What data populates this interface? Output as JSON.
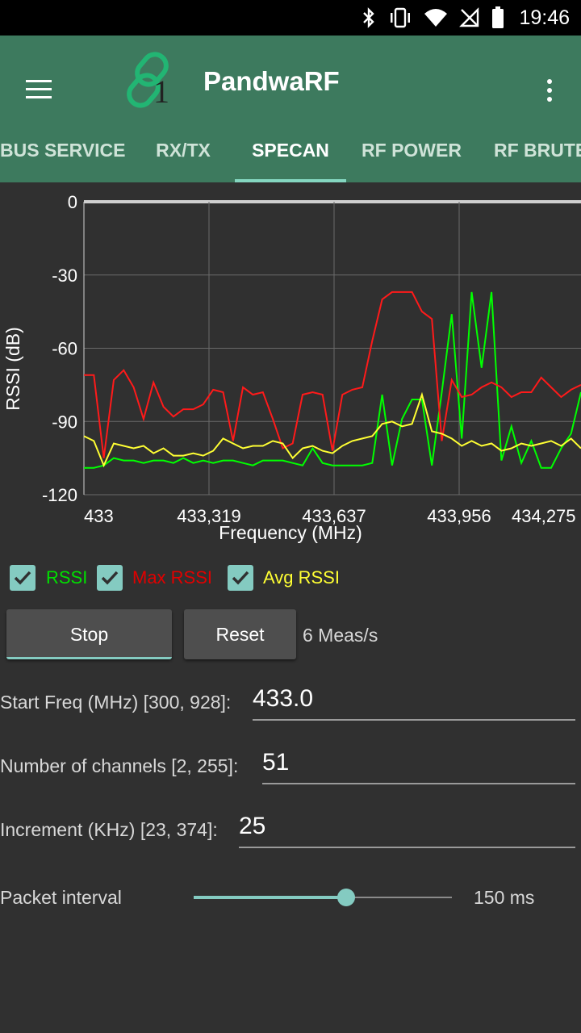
{
  "status_bar": {
    "time": "19:46",
    "icons": [
      "bluetooth-icon",
      "vibrate-icon",
      "wifi-icon",
      "no-signal-icon",
      "battery-icon"
    ]
  },
  "app_bar": {
    "title": "PandwaRF",
    "logo_number": "1",
    "tabs": [
      {
        "label": "BUS SERVICE"
      },
      {
        "label": "RX/TX"
      },
      {
        "label": "SPECAN"
      },
      {
        "label": "RF POWER"
      },
      {
        "label": "RF BRUTE"
      }
    ],
    "active_tab": "SPECAN"
  },
  "chart_data": {
    "type": "line",
    "xlabel": "Frequency (MHz)",
    "ylabel": "RSSI (dB)",
    "ylim": [
      -120,
      0
    ],
    "xlim": [
      433.0,
      434.25
    ],
    "x_ticks": [
      "433",
      "433,319",
      "433,637",
      "433,956",
      "434,275"
    ],
    "y_ticks": [
      "0",
      "-30",
      "-60",
      "-90",
      "-120"
    ],
    "grid": true,
    "x_start": 433.0,
    "x_step": 0.025,
    "series": [
      {
        "name": "RSSI",
        "color": "#00ff00",
        "values": [
          -109,
          -109,
          -108,
          -105,
          -106,
          -106,
          -107,
          -106,
          -106,
          -107,
          -105,
          -107,
          -106,
          -107,
          -106,
          -106,
          -107,
          -108,
          -106,
          -106,
          -106,
          -107,
          -108,
          -101,
          -107,
          -108,
          -108,
          -108,
          -108,
          -107,
          -79,
          -108,
          -89,
          -81,
          -81,
          -108,
          -78,
          -46,
          -97,
          -37,
          -68,
          -37,
          -106,
          -92,
          -107,
          -98,
          -109,
          -109,
          -101,
          -95,
          -78
        ]
      },
      {
        "name": "Max RSSI",
        "color": "#ff1a1a",
        "values": [
          -71,
          -71,
          -105,
          -73,
          -69,
          -76,
          -89,
          -74,
          -84,
          -88,
          -85,
          -85,
          -83,
          -77,
          -78,
          -98,
          -76,
          -79,
          -78,
          -89,
          -101,
          -99,
          -79,
          -78,
          -79,
          -102,
          -79,
          -77,
          -76,
          -57,
          -40,
          -37,
          -37,
          -37,
          -45,
          -48,
          -98,
          -73,
          -80,
          -79,
          -76,
          -74,
          -76,
          -80,
          -78,
          -78,
          -72,
          -76,
          -80,
          -77,
          -75
        ]
      },
      {
        "name": "Avg RSSI",
        "color": "#ffff33",
        "values": [
          -96,
          -98,
          -108,
          -99,
          -100,
          -101,
          -100,
          -103,
          -101,
          -104,
          -104,
          -103,
          -104,
          -102,
          -97,
          -99,
          -101,
          -100,
          -100,
          -98,
          -99,
          -105,
          -101,
          -100,
          -102,
          -103,
          -100,
          -98,
          -97,
          -96,
          -91,
          -90,
          -92,
          -91,
          -79,
          -94,
          -95,
          -97,
          -100,
          -98,
          -100,
          -99,
          -102,
          -101,
          -99,
          -100,
          -99,
          -98,
          -100,
          -97,
          -101
        ]
      }
    ]
  },
  "legend": [
    {
      "label": "RSSI",
      "color": "#00e000",
      "checked": true
    },
    {
      "label": "Max RSSI",
      "color": "#e00000",
      "checked": true
    },
    {
      "label": "Avg RSSI",
      "color": "#ffff33",
      "checked": true
    }
  ],
  "controls": {
    "stop_label": "Stop",
    "reset_label": "Reset",
    "rate": "6 Meas/s"
  },
  "fields": {
    "start_freq": {
      "label": "Start Freq (MHz) [300, 928]:",
      "value": "433.0"
    },
    "num_channels": {
      "label": "Number of channels [2, 255]:",
      "value": "51"
    },
    "increment": {
      "label": "Increment (KHz) [23, 374]:",
      "value": "25"
    }
  },
  "packet_interval": {
    "label": "Packet interval",
    "value_text": "150 ms",
    "fraction": 0.59
  }
}
